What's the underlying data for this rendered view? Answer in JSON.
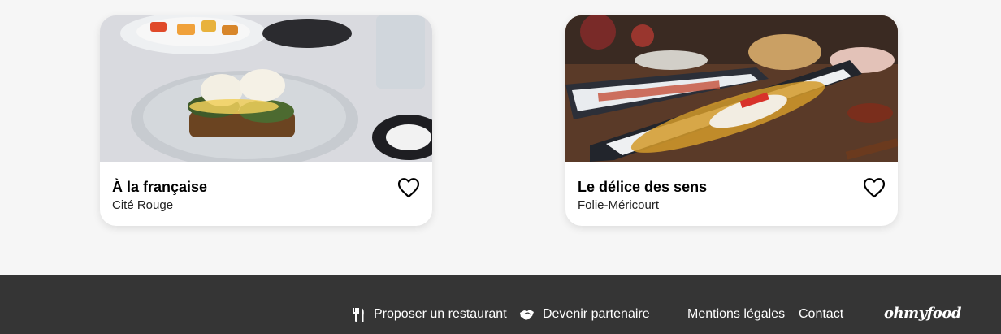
{
  "restaurants": [
    {
      "name": "À la française",
      "area": "Cité Rouge",
      "favorite_icon": "heart-outline-icon"
    },
    {
      "name": "Le délice des sens",
      "area": "Folie-Méricourt",
      "favorite_icon": "heart-outline-icon"
    }
  ],
  "footer": {
    "propose_label": "Proposer un restaurant",
    "propose_icon": "utensils-icon",
    "partner_label": "Devenir partenaire",
    "partner_icon": "handshake-icon",
    "legal_label": "Mentions légales",
    "contact_label": "Contact",
    "brand": "ohmyfood"
  },
  "colors": {
    "page_bg": "#f6f6f6",
    "footer_bg": "#353535",
    "card_bg": "#ffffff"
  }
}
